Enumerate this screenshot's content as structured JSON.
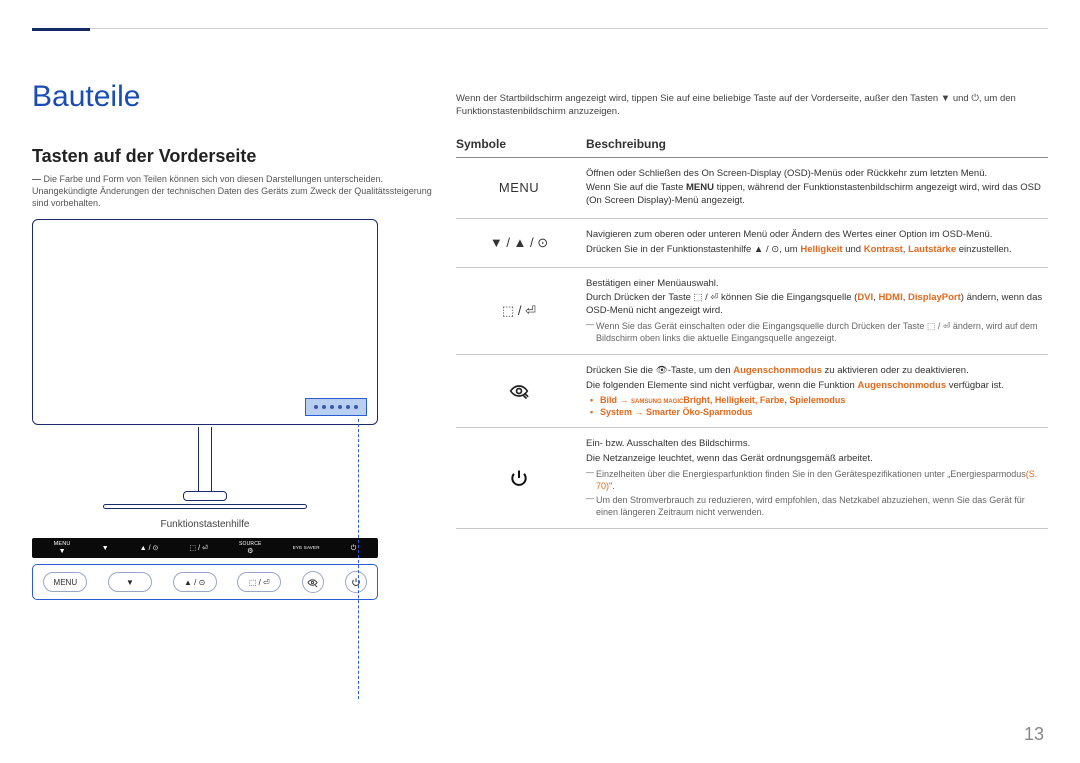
{
  "header": {
    "title": "Bauteile",
    "subtitle": "Tasten auf der Vorderseite",
    "note": "Die Farbe und Form von Teilen können sich von diesen Darstellungen unterscheiden. Unangekündigte Änderungen der technischen Daten des Geräts zum Zweck der Qualitätssteigerung sind vorbehalten."
  },
  "figure": {
    "caption": "Funktionstastenhilfe",
    "strip": [
      "MENU",
      "▼",
      "▲ / ⊙",
      "⬚ / ⏎",
      "SOURCE",
      "⚙",
      "EYE SAVER",
      "⏻"
    ],
    "pills": [
      "MENU",
      "▼",
      "▲ / ⊙",
      "⬚ / ⏎",
      "👁",
      "⏻"
    ]
  },
  "intro": "Wenn der Startbildschirm angezeigt wird, tippen Sie auf eine beliebige Taste auf der Vorderseite, außer den Tasten ▼ und ⏻, um den Funktionstastenbildschirm anzuzeigen.",
  "table": {
    "col1": "Symbole",
    "col2": "Beschreibung",
    "rows": [
      {
        "symbol_text": "MENU",
        "symbol_kind": "menu",
        "desc": {
          "p1": "Öffnen oder Schließen des On Screen-Display (OSD)-Menüs oder Rückkehr zum letzten Menü.",
          "p2_pre": "Wenn Sie auf die Taste ",
          "p2_bold": "MENU",
          "p2_post": " tippen, während der Funktionstastenbildschirm angezeigt wird, wird das OSD (On Screen Display)-Menü angezeigt."
        }
      },
      {
        "symbol_text": "▼ / ▲ / ⊙",
        "symbol_kind": "nav",
        "desc": {
          "p1": "Navigieren zum oberen oder unteren Menü oder Ändern des Wertes einer Option im OSD-Menü.",
          "p2_pre": "Drücken Sie in der Funktionstastenhilfe ▲ / ⊙, um ",
          "hl1": "Helligkeit",
          "mid1": " und ",
          "hl2": "Kontrast",
          "mid2": ", ",
          "hl3": "Lautstärke",
          "p2_post": " einzustellen."
        }
      },
      {
        "symbol_text": "⬚ / ⏎",
        "symbol_kind": "enter",
        "desc": {
          "p1": "Bestätigen einer Menüauswahl.",
          "p2_pre": "Durch Drücken der Taste ⬚ / ⏎ können Sie die Eingangsquelle (",
          "hl1": "DVI",
          "c1": ", ",
          "hl2": "HDMI",
          "c2": ", ",
          "hl3": "DisplayPort",
          "p2_post": ") ändern, wenn das OSD-Menü nicht angezeigt wird.",
          "p3": "Wenn Sie das Gerät einschalten oder die Eingangsquelle durch Drücken der Taste ⬚ / ⏎ ändern, wird auf dem Bildschirm oben links die aktuelle Eingangsquelle angezeigt."
        }
      },
      {
        "symbol_text": "eye",
        "symbol_kind": "eye",
        "desc": {
          "p1_pre": "Drücken Sie die 👁-Taste, um den ",
          "hl1": "Augenschonmodus",
          "p1_post": " zu aktivieren oder zu deaktivieren.",
          "p2_pre": "Die folgenden Elemente sind nicht verfügbar, wenn die Funktion ",
          "hl2": "Augenschonmodus",
          "p2_post": " verfügbar ist.",
          "b1_pre": "Bild → ",
          "b1_tiny": "SAMSUNG MAGIC",
          "b1_main": "Bright",
          "b1_rest": ", Helligkeit, Farbe, Spielemodus",
          "b2": "System → Smarter Öko-Sparmodus"
        }
      },
      {
        "symbol_text": "⏻",
        "symbol_kind": "power",
        "desc": {
          "p1": "Ein- bzw. Ausschalten des Bildschirms.",
          "p2": "Die Netzanzeige leuchtet, wenn das Gerät ordnungsgemäß arbeitet.",
          "p3_pre": "Einzelheiten über die Energiesparfunktion finden Sie in den Gerätespezifikationen unter „Energiesparmodus",
          "p3_link": "(S. 70)",
          "p3_post": "\".",
          "p4": "Um den Stromverbrauch zu reduzieren, wird empfohlen, das Netzkabel abzuziehen, wenn Sie das Gerät für einen längeren Zeitraum nicht verwenden."
        }
      }
    ]
  },
  "page_number": "13"
}
